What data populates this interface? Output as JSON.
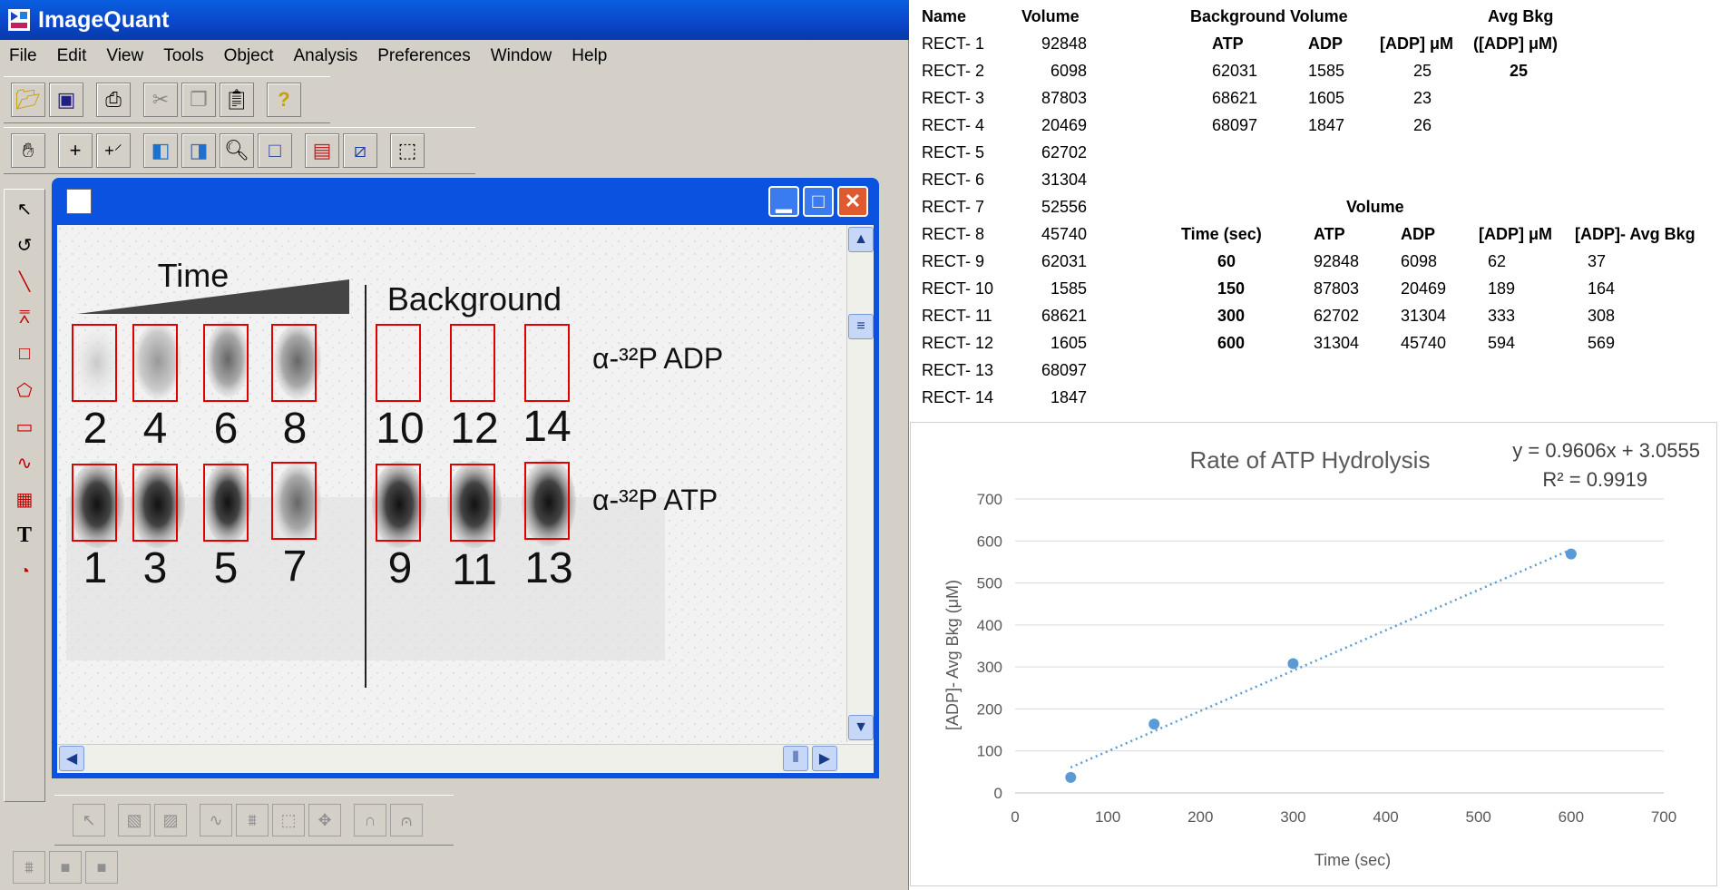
{
  "app": {
    "title": "ImageQuant"
  },
  "menu": [
    "File",
    "Edit",
    "View",
    "Tools",
    "Object",
    "Analysis",
    "Preferences",
    "Window",
    "Help"
  ],
  "gel": {
    "time_label": "Time",
    "background_label": "Background",
    "adp_label": "α-³²P ADP",
    "atp_label": "α-³²P ATP",
    "top_lane_numbers": [
      "2",
      "4",
      "6",
      "8",
      "10",
      "12",
      "14"
    ],
    "bottom_lane_numbers": [
      "1",
      "3",
      "5",
      "7",
      "9",
      "11",
      "13"
    ]
  },
  "rect_table": {
    "headers": [
      "Name",
      "Volume"
    ],
    "rows": [
      [
        "RECT-  1",
        "92848"
      ],
      [
        "RECT-  2",
        "6098"
      ],
      [
        "RECT-  3",
        "87803"
      ],
      [
        "RECT-  4",
        "20469"
      ],
      [
        "RECT-  5",
        "62702"
      ],
      [
        "RECT-  6",
        "31304"
      ],
      [
        "RECT-  7",
        "52556"
      ],
      [
        "RECT-  8",
        "45740"
      ],
      [
        "RECT-  9",
        "62031"
      ],
      [
        "RECT-  10",
        "1585"
      ],
      [
        "RECT-  11",
        "68621"
      ],
      [
        "RECT-  12",
        "1605"
      ],
      [
        "RECT-  13",
        "68097"
      ],
      [
        "RECT-  14",
        "1847"
      ]
    ]
  },
  "bkg_table": {
    "title": "Background Volume",
    "avg_title": "Avg Bkg",
    "headers": [
      "ATP",
      "ADP",
      "[ADP] μM",
      "([ADP] μM)"
    ],
    "rows": [
      [
        "62031",
        "1585",
        "25"
      ],
      [
        "68621",
        "1605",
        "23"
      ],
      [
        "68097",
        "1847",
        "26"
      ]
    ],
    "avg_value": "25"
  },
  "vol_table": {
    "title": "Volume",
    "headers": [
      "Time (sec)",
      "ATP",
      "ADP",
      "[ADP] μM",
      "[ADP]- Avg Bkg"
    ],
    "rows": [
      [
        "60",
        "92848",
        "6098",
        "62",
        "37"
      ],
      [
        "150",
        "87803",
        "20469",
        "189",
        "164"
      ],
      [
        "300",
        "62702",
        "31304",
        "333",
        "308"
      ],
      [
        "600",
        "31304",
        "45740",
        "594",
        "569"
      ]
    ]
  },
  "chart_data": {
    "type": "scatter",
    "title": "Rate of ATP Hydrolysis",
    "equation": "y = 0.9606x + 3.0555",
    "r2": "R² = 0.9919",
    "xlabel": "Time (sec)",
    "ylabel": "[ADP]- Avg Bkg (μM)",
    "xlim": [
      0,
      700
    ],
    "ylim": [
      0,
      700
    ],
    "xticks": [
      "0",
      "100",
      "200",
      "300",
      "400",
      "500",
      "600",
      "700"
    ],
    "yticks": [
      "0",
      "100",
      "200",
      "300",
      "400",
      "500",
      "600",
      "700"
    ],
    "x": [
      60,
      150,
      300,
      600
    ],
    "y": [
      37,
      164,
      308,
      569
    ],
    "trendline": {
      "slope": 0.9606,
      "intercept": 3.0555
    },
    "color": "#5b9bd5",
    "grid": true
  }
}
